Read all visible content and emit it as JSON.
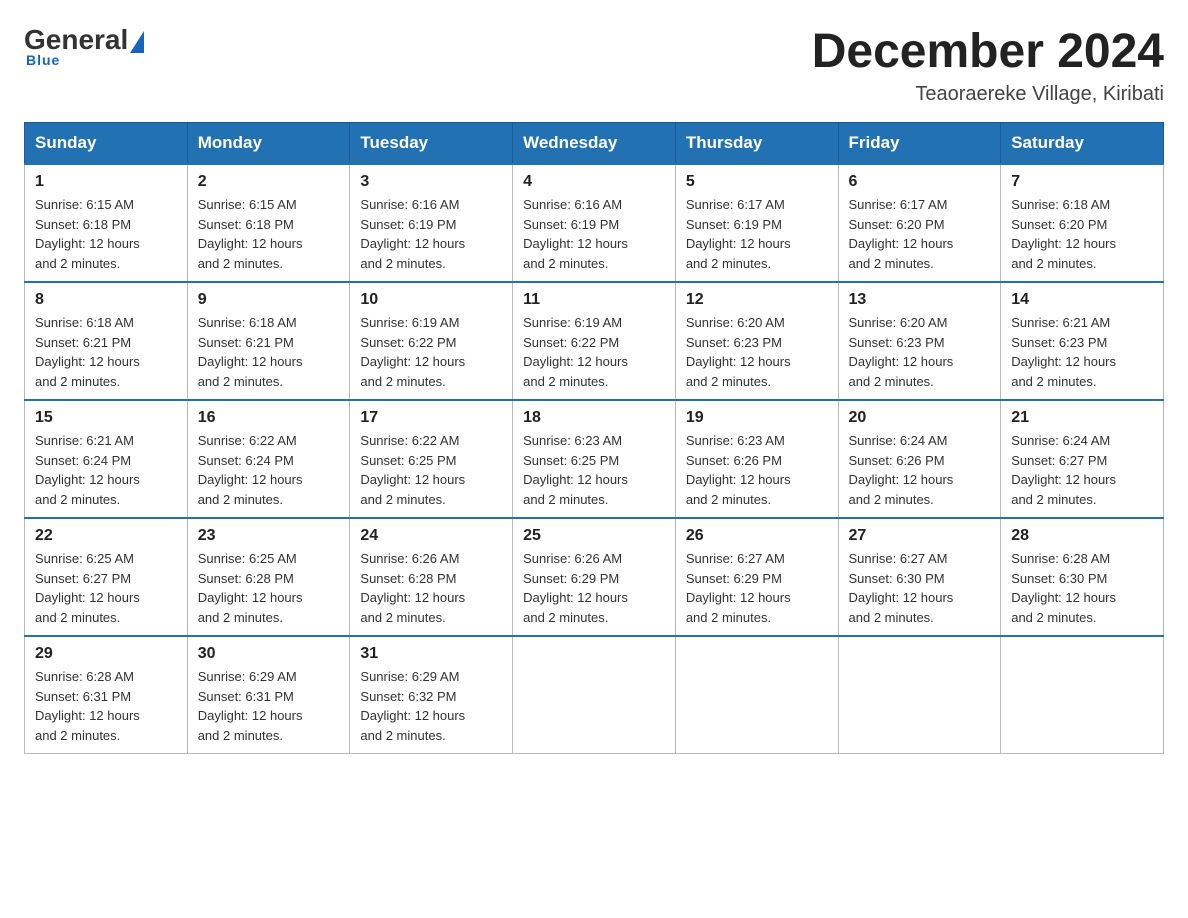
{
  "header": {
    "logo": {
      "general": "General",
      "blue": "Blue",
      "underline": "Blue"
    },
    "title": "December 2024",
    "location": "Teaoraereke Village, Kiribati"
  },
  "days_of_week": [
    "Sunday",
    "Monday",
    "Tuesday",
    "Wednesday",
    "Thursday",
    "Friday",
    "Saturday"
  ],
  "weeks": [
    [
      {
        "day": "1",
        "sunrise": "6:15 AM",
        "sunset": "6:18 PM",
        "daylight": "12 hours and 2 minutes."
      },
      {
        "day": "2",
        "sunrise": "6:15 AM",
        "sunset": "6:18 PM",
        "daylight": "12 hours and 2 minutes."
      },
      {
        "day": "3",
        "sunrise": "6:16 AM",
        "sunset": "6:19 PM",
        "daylight": "12 hours and 2 minutes."
      },
      {
        "day": "4",
        "sunrise": "6:16 AM",
        "sunset": "6:19 PM",
        "daylight": "12 hours and 2 minutes."
      },
      {
        "day": "5",
        "sunrise": "6:17 AM",
        "sunset": "6:19 PM",
        "daylight": "12 hours and 2 minutes."
      },
      {
        "day": "6",
        "sunrise": "6:17 AM",
        "sunset": "6:20 PM",
        "daylight": "12 hours and 2 minutes."
      },
      {
        "day": "7",
        "sunrise": "6:18 AM",
        "sunset": "6:20 PM",
        "daylight": "12 hours and 2 minutes."
      }
    ],
    [
      {
        "day": "8",
        "sunrise": "6:18 AM",
        "sunset": "6:21 PM",
        "daylight": "12 hours and 2 minutes."
      },
      {
        "day": "9",
        "sunrise": "6:18 AM",
        "sunset": "6:21 PM",
        "daylight": "12 hours and 2 minutes."
      },
      {
        "day": "10",
        "sunrise": "6:19 AM",
        "sunset": "6:22 PM",
        "daylight": "12 hours and 2 minutes."
      },
      {
        "day": "11",
        "sunrise": "6:19 AM",
        "sunset": "6:22 PM",
        "daylight": "12 hours and 2 minutes."
      },
      {
        "day": "12",
        "sunrise": "6:20 AM",
        "sunset": "6:23 PM",
        "daylight": "12 hours and 2 minutes."
      },
      {
        "day": "13",
        "sunrise": "6:20 AM",
        "sunset": "6:23 PM",
        "daylight": "12 hours and 2 minutes."
      },
      {
        "day": "14",
        "sunrise": "6:21 AM",
        "sunset": "6:23 PM",
        "daylight": "12 hours and 2 minutes."
      }
    ],
    [
      {
        "day": "15",
        "sunrise": "6:21 AM",
        "sunset": "6:24 PM",
        "daylight": "12 hours and 2 minutes."
      },
      {
        "day": "16",
        "sunrise": "6:22 AM",
        "sunset": "6:24 PM",
        "daylight": "12 hours and 2 minutes."
      },
      {
        "day": "17",
        "sunrise": "6:22 AM",
        "sunset": "6:25 PM",
        "daylight": "12 hours and 2 minutes."
      },
      {
        "day": "18",
        "sunrise": "6:23 AM",
        "sunset": "6:25 PM",
        "daylight": "12 hours and 2 minutes."
      },
      {
        "day": "19",
        "sunrise": "6:23 AM",
        "sunset": "6:26 PM",
        "daylight": "12 hours and 2 minutes."
      },
      {
        "day": "20",
        "sunrise": "6:24 AM",
        "sunset": "6:26 PM",
        "daylight": "12 hours and 2 minutes."
      },
      {
        "day": "21",
        "sunrise": "6:24 AM",
        "sunset": "6:27 PM",
        "daylight": "12 hours and 2 minutes."
      }
    ],
    [
      {
        "day": "22",
        "sunrise": "6:25 AM",
        "sunset": "6:27 PM",
        "daylight": "12 hours and 2 minutes."
      },
      {
        "day": "23",
        "sunrise": "6:25 AM",
        "sunset": "6:28 PM",
        "daylight": "12 hours and 2 minutes."
      },
      {
        "day": "24",
        "sunrise": "6:26 AM",
        "sunset": "6:28 PM",
        "daylight": "12 hours and 2 minutes."
      },
      {
        "day": "25",
        "sunrise": "6:26 AM",
        "sunset": "6:29 PM",
        "daylight": "12 hours and 2 minutes."
      },
      {
        "day": "26",
        "sunrise": "6:27 AM",
        "sunset": "6:29 PM",
        "daylight": "12 hours and 2 minutes."
      },
      {
        "day": "27",
        "sunrise": "6:27 AM",
        "sunset": "6:30 PM",
        "daylight": "12 hours and 2 minutes."
      },
      {
        "day": "28",
        "sunrise": "6:28 AM",
        "sunset": "6:30 PM",
        "daylight": "12 hours and 2 minutes."
      }
    ],
    [
      {
        "day": "29",
        "sunrise": "6:28 AM",
        "sunset": "6:31 PM",
        "daylight": "12 hours and 2 minutes."
      },
      {
        "day": "30",
        "sunrise": "6:29 AM",
        "sunset": "6:31 PM",
        "daylight": "12 hours and 2 minutes."
      },
      {
        "day": "31",
        "sunrise": "6:29 AM",
        "sunset": "6:32 PM",
        "daylight": "12 hours and 2 minutes."
      },
      null,
      null,
      null,
      null
    ]
  ],
  "labels": {
    "sunrise": "Sunrise:",
    "sunset": "Sunset:",
    "daylight": "Daylight:"
  }
}
